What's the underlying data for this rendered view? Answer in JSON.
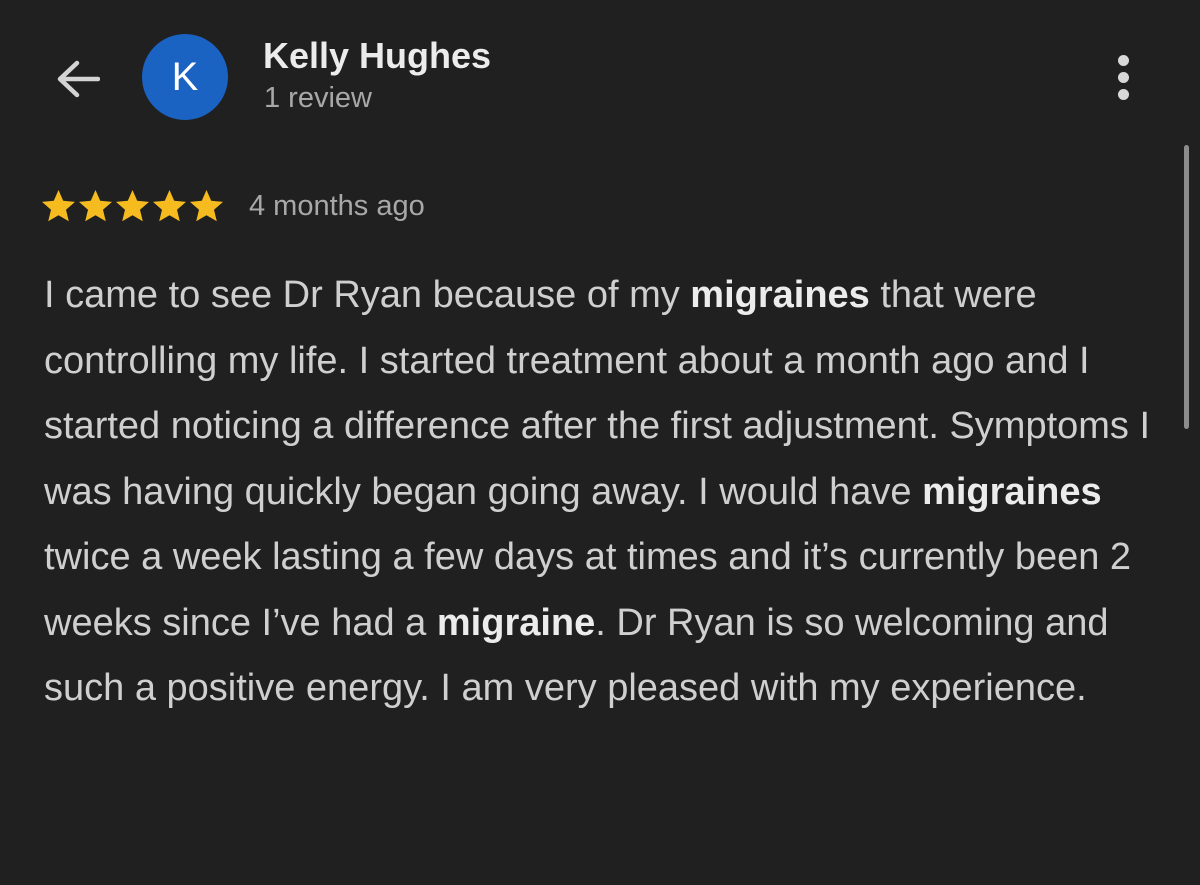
{
  "header": {
    "back_icon": "arrow-left-icon",
    "avatar_letter": "K",
    "avatar_color": "#1a63c2",
    "author_name": "Kelly Hughes",
    "review_count": "1 review",
    "more_icon": "more-vertical-icon"
  },
  "review": {
    "rating": 5,
    "rating_max": 5,
    "star_color": "#f6bb1e",
    "date": "4 months ago",
    "segments": [
      {
        "text": "I came to see Dr Ryan because of my ",
        "bold": false
      },
      {
        "text": "migraines",
        "bold": true
      },
      {
        "text": " that were controlling my life. I started treatment about a month ago and I started noticing a difference after the first adjustment. Symptoms I was having quickly began going away. I would have ",
        "bold": false
      },
      {
        "text": "migraines",
        "bold": true
      },
      {
        "text": " twice a week lasting a few days at times and it’s currently been 2 weeks since I’ve had a ",
        "bold": false
      },
      {
        "text": "migraine",
        "bold": true
      },
      {
        "text": ". Dr Ryan is so welcoming and such a positive energy. I am very pleased with my experience.",
        "bold": false
      }
    ]
  },
  "colors": {
    "background": "#202020",
    "text_primary": "#ececec",
    "text_body": "#cfcfcf",
    "text_secondary": "#a8a8a8"
  }
}
